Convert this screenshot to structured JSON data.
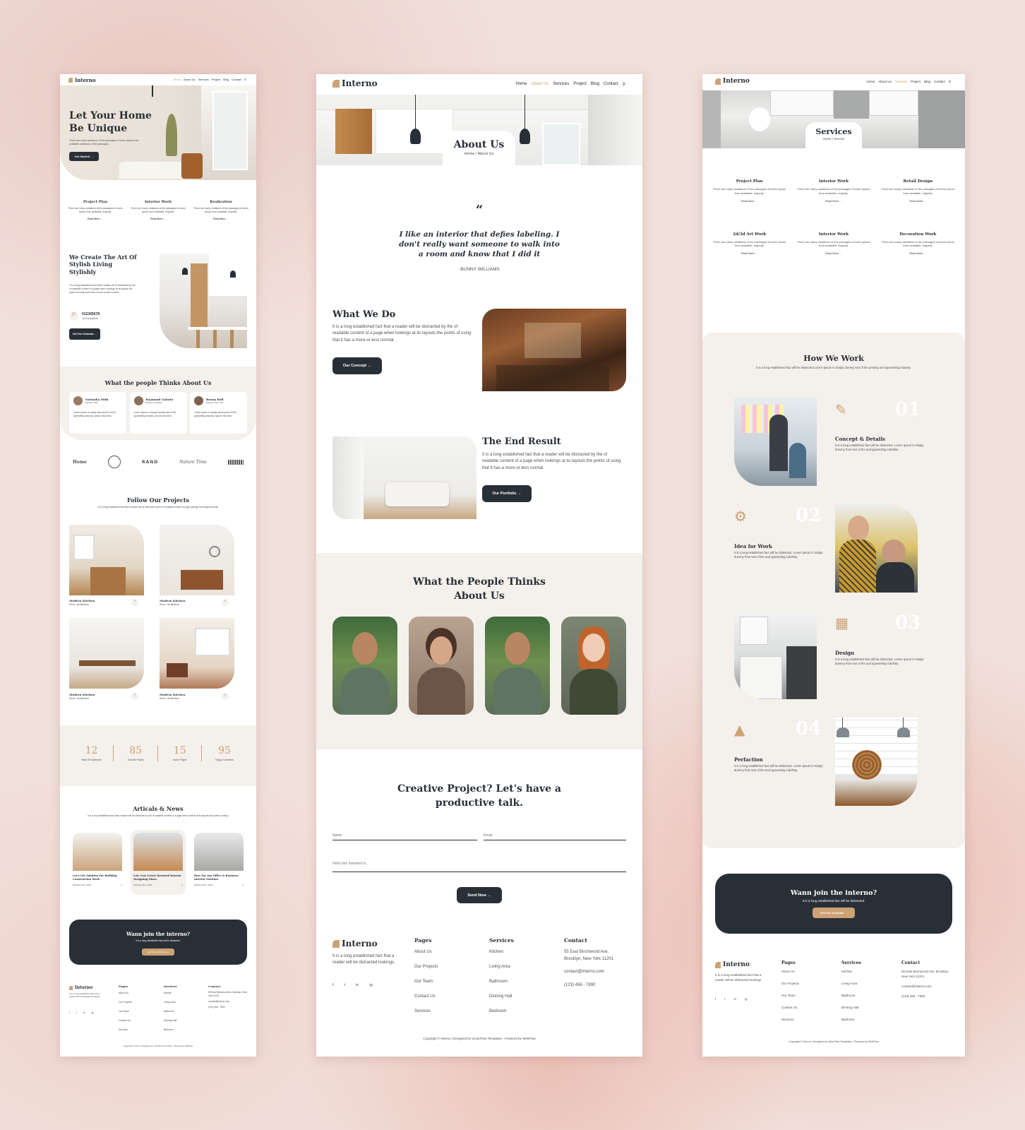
{
  "brand": "Interno",
  "nav": [
    "Home",
    "About Us",
    "Services",
    "Project",
    "Blog",
    "Contact"
  ],
  "nav_compact": [
    "Home",
    "About Us",
    "Services",
    "Project",
    "Blog",
    "Contact"
  ],
  "colors": {
    "accent": "#cda274",
    "dark": "#292f36",
    "beige": "#f4f0ec",
    "background": "#f1dfda"
  },
  "icons": {
    "search": "search-icon",
    "arrow": "arrow-right-icon",
    "phone": "phone-icon",
    "quote": "quote-icon"
  },
  "home": {
    "hero_title": "Let Your Home Be Unique",
    "hero_text": "There are many variations of the passages of lorem Ipsum from available variations of the passages.",
    "hero_button": "Get Started",
    "features": [
      {
        "title": "Project Plan",
        "text": "There are many variations of the passages of lorem Ipsum from available, majority.",
        "link": "Read More"
      },
      {
        "title": "Interior Work",
        "text": "There are many variations of the passages of lorem Ipsum from available, majority.",
        "link": "Read More"
      },
      {
        "title": "Realization",
        "text": "There are many variations of the passages of lorem Ipsum from available, majority.",
        "link": "Read More"
      }
    ],
    "about_title": "We Create The Art Of Stylish Living Stylishly",
    "about_text": "It is a long established fact that a reader will be distracted by the of readable content of a page when lookings at its layouts the points of using that it has a more-or-less normal.",
    "phone": "012345678",
    "phone_label": "Call Us Anytime",
    "about_button": "Get Free Estimate",
    "testimonials_title": "What the people Thinks About Us",
    "testimonials": [
      {
        "name": "Nattasha Mith",
        "place": "Sydney, USA",
        "text": "Lorem Ipsum is simply dummy text of the typesetting industry. Ipsum has been."
      },
      {
        "name": "Raymond Galario",
        "place": "Sydney, Australia",
        "text": "Lorem Ipsum is simply dummy text of the typesetting industry. Ipsum has been."
      },
      {
        "name": "Benny Roll",
        "place": "Sydney, New York",
        "text": "Lorem Ipsum is simply dummy text of the typesetting industry. Ipsum has been."
      }
    ],
    "brands": [
      "Home",
      "RAND",
      "Nature Time"
    ],
    "projects_title": "Follow Our Projects",
    "projects_text": "It is a long established fact that a reader will be distracted by the of readable content of page lookings at its layouts points.",
    "projects": [
      {
        "title": "Modern Kitchen",
        "cat": "Decor / Architecture"
      },
      {
        "title": "Modern Kitchen",
        "cat": "Decor / Architecture"
      },
      {
        "title": "Modern Kitchen",
        "cat": "Decor / Architecture"
      },
      {
        "title": "Modern Kitchen",
        "cat": "Decor / Architecture"
      }
    ],
    "stats": [
      {
        "value": "12",
        "label": "Years Of Experiance"
      },
      {
        "value": "85",
        "label": "Success Project"
      },
      {
        "value": "15",
        "label": "Active Project"
      },
      {
        "value": "95",
        "label": "Happy Customers"
      }
    ],
    "news_title": "Articals & News",
    "news_text": "It is a long established fact that a reader will be distracted by the of readable content of a page when lookinfs at its layouts the points of using.",
    "news": [
      {
        "tag": "Kitchan Design",
        "title": "Let's Get Solution For Building Construction Work",
        "date": "26 December, 2022"
      },
      {
        "tag": "Living Design",
        "title": "Low Cost Latest Invented Interior Designing Ideas.",
        "date": "22 December, 2022"
      },
      {
        "tag": "Interior Design",
        "title": "Best For Any Office & Business Interior Solution",
        "date": "25 December, 2022"
      }
    ],
    "cta_title": "Wann join the interno?",
    "cta_text": "It is a long established fact will be distracted.",
    "cta_button": "Get Free Estimate",
    "copyright": "Copyright © Interno | Designed by VictorFlow Templates - Powered by Webflow"
  },
  "about": {
    "banner_title": "About Us",
    "breadcrumb": "Home / About Us",
    "quote": "I like an interior that defies labeling. I don't really want someone to walk into a room and know that I did it",
    "quote_author": "-BUNNY WILLIAMS",
    "what_title": "What We Do",
    "what_text": "It is a long established fact that a reader will be distracted by the of readable content of a page when lookings at its layouts the points of using that it has a more-or-less normal.",
    "what_button": "Our Concept",
    "end_title": "The End Result",
    "end_text": "It is a long established fact that a reader will be distracted by the of readable content of a page when lookings at its layouts the points of using that it has a more-or-less normal.",
    "end_button": "Our Portfolio",
    "people_title": "What the People Thinks About Us",
    "contact_title": "Creative Project? Let's have a productive talk.",
    "name_placeholder": "Name",
    "email_placeholder": "Email",
    "message_placeholder": "Hello Iam Intrested in..",
    "send_button": "Send Now"
  },
  "services": {
    "banner_title": "Services",
    "breadcrumb": "Home / Service",
    "items": [
      {
        "title": "Project Plan",
        "text": "There are many variations of the passages of lorem Ipsum from available, majority.",
        "link": "Read More"
      },
      {
        "title": "Interior Work",
        "text": "There are many variations of the passages of lorem Ipsum from available, majority.",
        "link": "Read More"
      },
      {
        "title": "Retail Design",
        "text": "There are many variations of the passages of lorem Ipsum from available, majority.",
        "link": "Read More"
      },
      {
        "title": "2d/3d Art Work",
        "text": "There are many variations of the passages of lorem Ipsum from available, majority.",
        "link": "Read More"
      },
      {
        "title": "Interior Work",
        "text": "There are many variations of the passages of lorem Ipsum from available, majority.",
        "link": "Read More"
      },
      {
        "title": "Decoration Work",
        "text": "There are many variations of the passages of lorem Ipsum from available, majority.",
        "link": "Read More"
      }
    ],
    "how_title": "How We Work",
    "how_text": "It is a long established fact will be distracted.Lorem Ipsum is simply dummy text of the printing and typesetting industry.",
    "steps": [
      {
        "num": "01",
        "title": "Concept & Details",
        "text": "It is a long established fact will be distracted. Lorem Ipsum is simply dummy from text of the and typesetting indufstry."
      },
      {
        "num": "02",
        "title": "Idea for Work",
        "text": "It is a long established fact will be distracted. Lorem Ipsum is simply dummy from text of the and typesetting indufstry."
      },
      {
        "num": "03",
        "title": "Design",
        "text": "It is a long established fact will be distracted. Lorem Ipsum is simply dummy from text of the and typesetting indufstry."
      },
      {
        "num": "04",
        "title": "Perfaction",
        "text": "It is a long established fact will be distracted. Lorem Ipsum is simply dummy from text of the and typesetting indufstry."
      }
    ]
  },
  "footer": {
    "about": "It is a long established fact that a reader will be distracted lookings.",
    "pages_title": "Pages",
    "pages": [
      "About Us",
      "Our Projects",
      "Our Team",
      "Contact Us",
      "Services"
    ],
    "services_title": "Services",
    "services": [
      "Kitchen",
      "Living Area",
      "Bathroom",
      "Dinning Hall",
      "Bedroom"
    ],
    "contact_title": "Contact",
    "address": "55 East Birchwood Ave. Brooklyn, New York 11201",
    "email": "contact@interno.com",
    "phone": "(123) 456 - 7890",
    "social": [
      "f",
      "t",
      "in",
      "ig"
    ],
    "copyright": "Copyright © Interno | Designed by VictorFlow Templates - Powered by WebFlow"
  }
}
